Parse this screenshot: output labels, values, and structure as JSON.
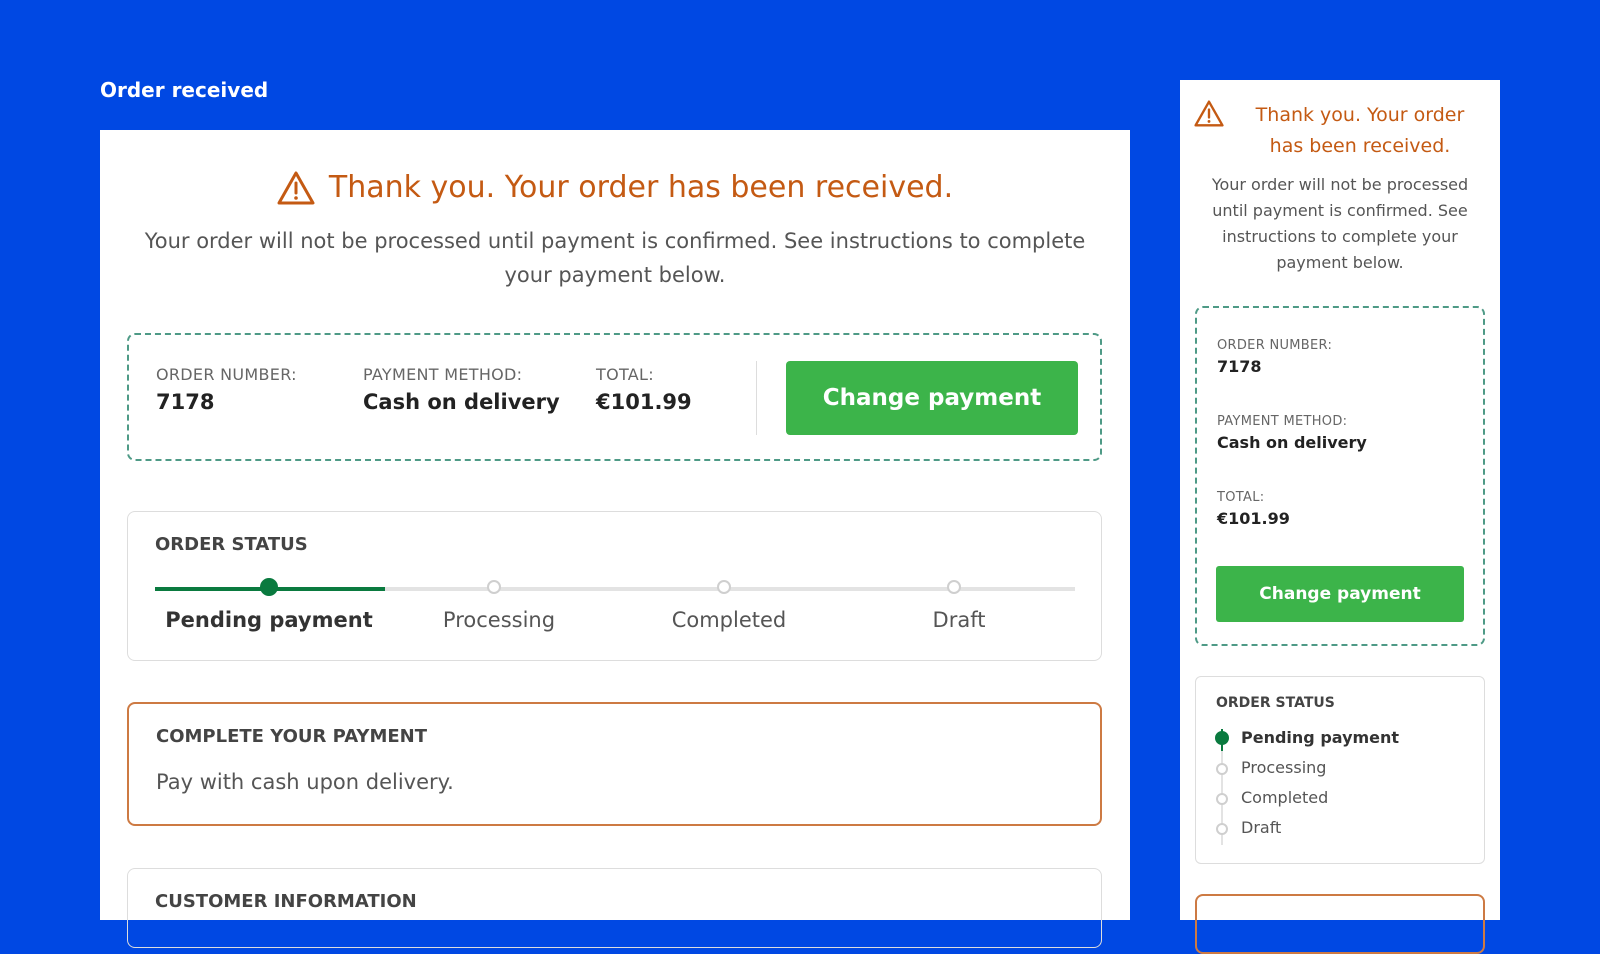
{
  "page": {
    "heading": "Order received"
  },
  "notice": {
    "title": "Thank you. Your order has been received.",
    "message": "Your order will not be processed until payment is confirmed. See instructions to complete your payment below."
  },
  "order_summary": {
    "order_number_label": "ORDER NUMBER:",
    "order_number": "7178",
    "payment_method_label": "PAYMENT METHOD:",
    "payment_method": "Cash on delivery",
    "total_label": "TOTAL:",
    "total": "€101.99",
    "change_payment_label": "Change payment"
  },
  "order_status": {
    "title": "ORDER STATUS",
    "steps": [
      {
        "label": "Pending payment",
        "active": true
      },
      {
        "label": "Processing",
        "active": false
      },
      {
        "label": "Completed",
        "active": false
      },
      {
        "label": "Draft",
        "active": false
      }
    ]
  },
  "complete_payment": {
    "title": "COMPLETE YOUR PAYMENT",
    "text": "Pay with cash upon delivery."
  },
  "customer_information": {
    "title": "CUSTOMER INFORMATION"
  },
  "colors": {
    "background": "#0048e3",
    "warning": "#c45a13",
    "button": "#3cb44a",
    "status_active": "#0a7a3f",
    "dashed_border": "#4e9a86",
    "payment_border": "#cd7a43"
  },
  "icons": {
    "warning": "warning-triangle-icon"
  }
}
